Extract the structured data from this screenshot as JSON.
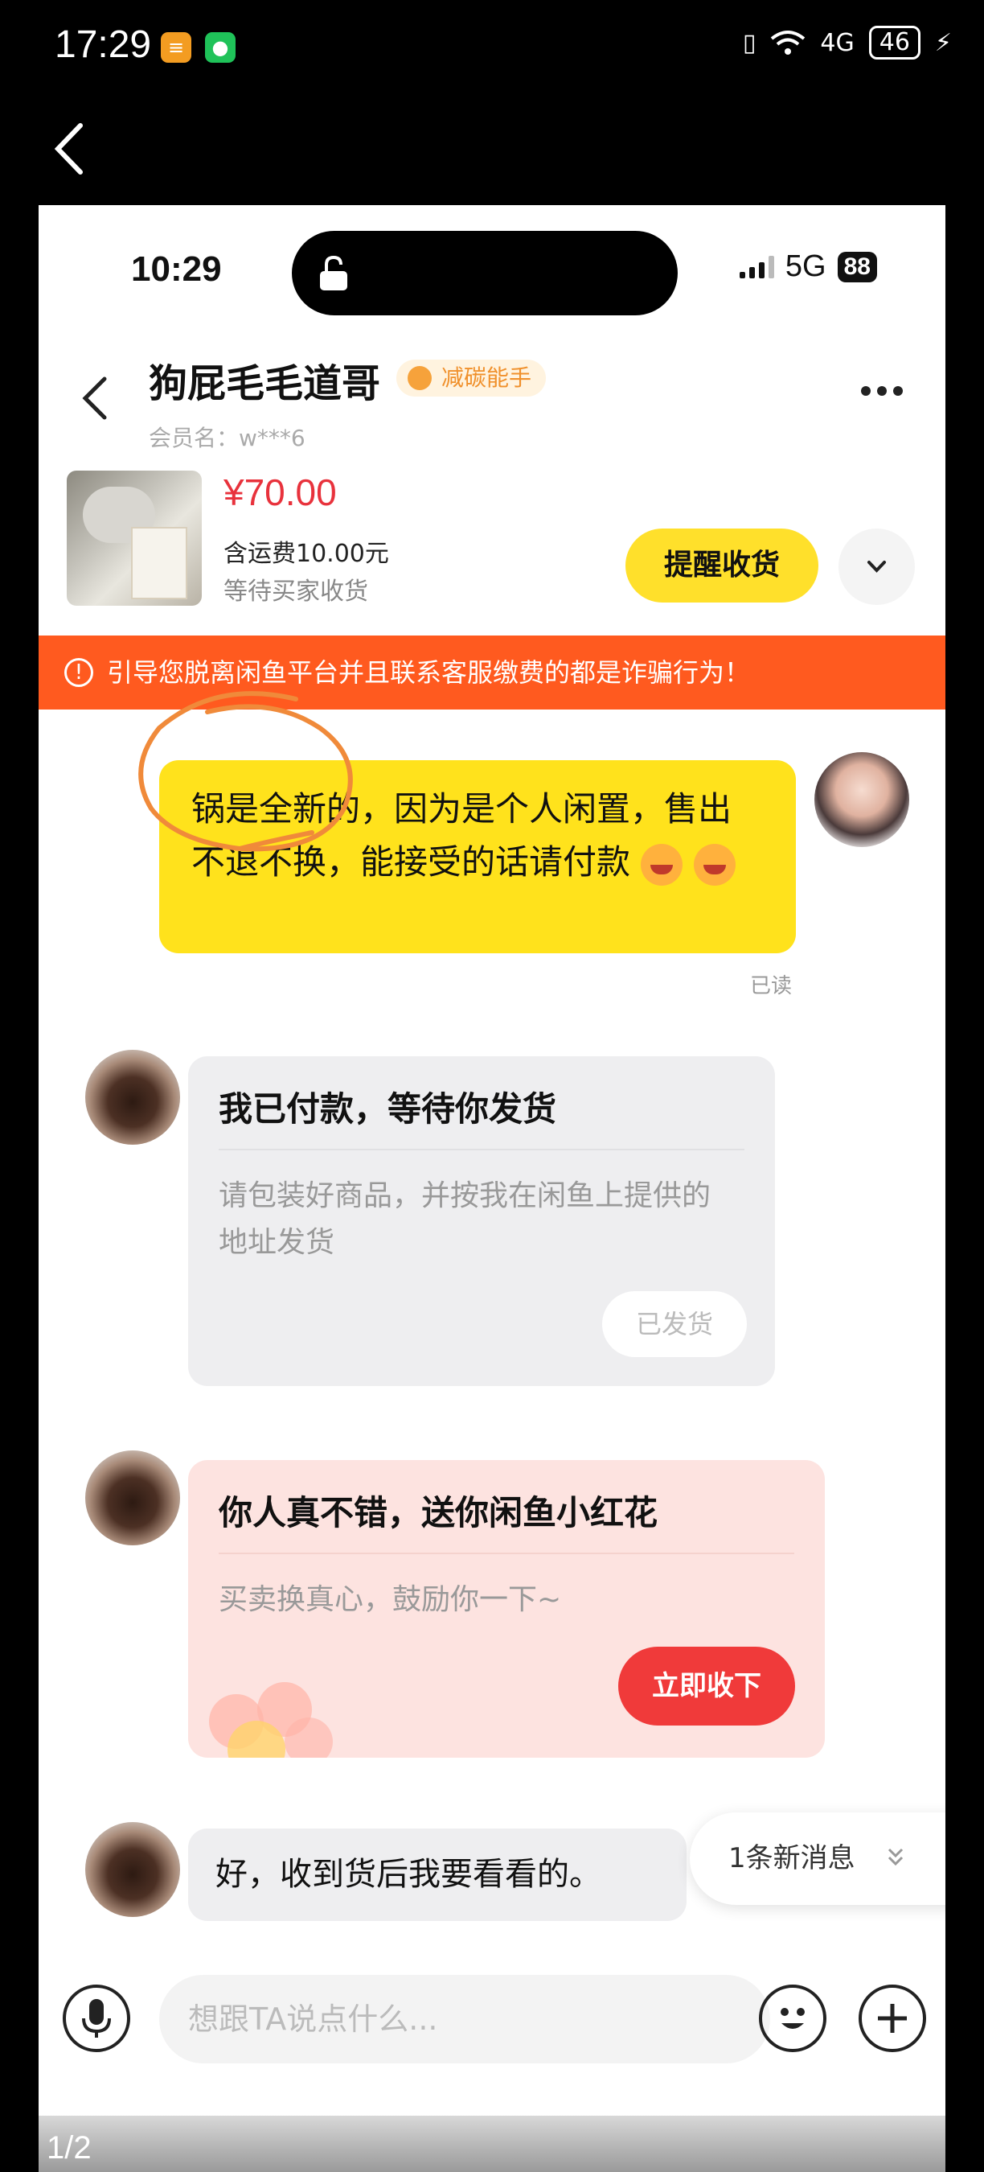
{
  "outer_status": {
    "time": "17:29",
    "network": "4G",
    "battery": "46"
  },
  "inner_status": {
    "time": "10:29",
    "network": "5G",
    "battery": "88"
  },
  "header": {
    "seller_name": "狗屁毛毛道哥",
    "badge": "减碳能手",
    "member": "会员名：w***6"
  },
  "order": {
    "price": "¥70.00",
    "shipping": "含运费10.00元",
    "status": "等待买家收货",
    "remind_button": "提醒收货"
  },
  "warning": "引导您脱离闲鱼平台并且联系客服缴费的都是诈骗行为！",
  "messages": {
    "seller_message": "锅是全新的，因为是个人闲置，售出不退不换，能接受的话请付款",
    "read_status": "已读",
    "payment_card": {
      "title": "我已付款，等待你发货",
      "body": "请包装好商品，并按我在闲鱼上提供的地址发货",
      "button": "已发货"
    },
    "flower_card": {
      "title": "你人真不错，送你闲鱼小红花",
      "body": "买卖换真心，鼓励你一下~",
      "button": "立即收下"
    },
    "last_message": "好，收到货后我要看看的。",
    "new_message_hint": "1条新消息"
  },
  "input": {
    "placeholder": "想跟TA说点什么..."
  },
  "page_indicator": "1/2",
  "colors": {
    "accent_yellow": "#ffe21c",
    "warning_orange": "#ff5a1f",
    "price_red": "#e8323c",
    "accept_red": "#f03a3a"
  }
}
